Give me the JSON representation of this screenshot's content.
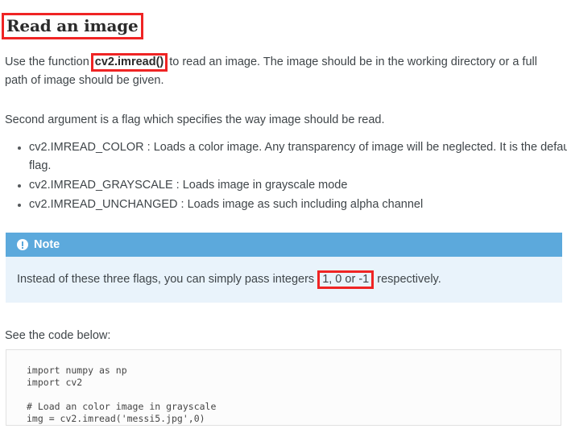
{
  "heading": {
    "text": "Read an image",
    "annotation_color": "#ef2424"
  },
  "paragraphs": {
    "intro_before": "Use the function",
    "intro_code": "cv2.imread()",
    "intro_after": "to read an image. The image should be in the working directory or a full path of image should be given.",
    "second": "Second argument is a flag which specifies the way image should be read.",
    "see_code": "See the code below:"
  },
  "flags": [
    "cv2.IMREAD_COLOR : Loads a color image. Any transparency of image will be neglected. It is the default flag.",
    "cv2.IMREAD_GRAYSCALE : Loads image in grayscale mode",
    "cv2.IMREAD_UNCHANGED : Loads image as such including alpha channel"
  ],
  "note": {
    "icon": "exclamation-circle-icon",
    "title": "Note",
    "body_before": "Instead of these three flags, you can simply pass integers",
    "body_highlight": "1, 0 or -1",
    "body_after": "respectively.",
    "header_color": "#5ca9dc",
    "body_color": "#e9f3fb"
  },
  "code": {
    "language": "python",
    "text": "import numpy as np\nimport cv2\n\n# Load an color image in grayscale\nimg = cv2.imread('messi5.jpg',0)"
  }
}
